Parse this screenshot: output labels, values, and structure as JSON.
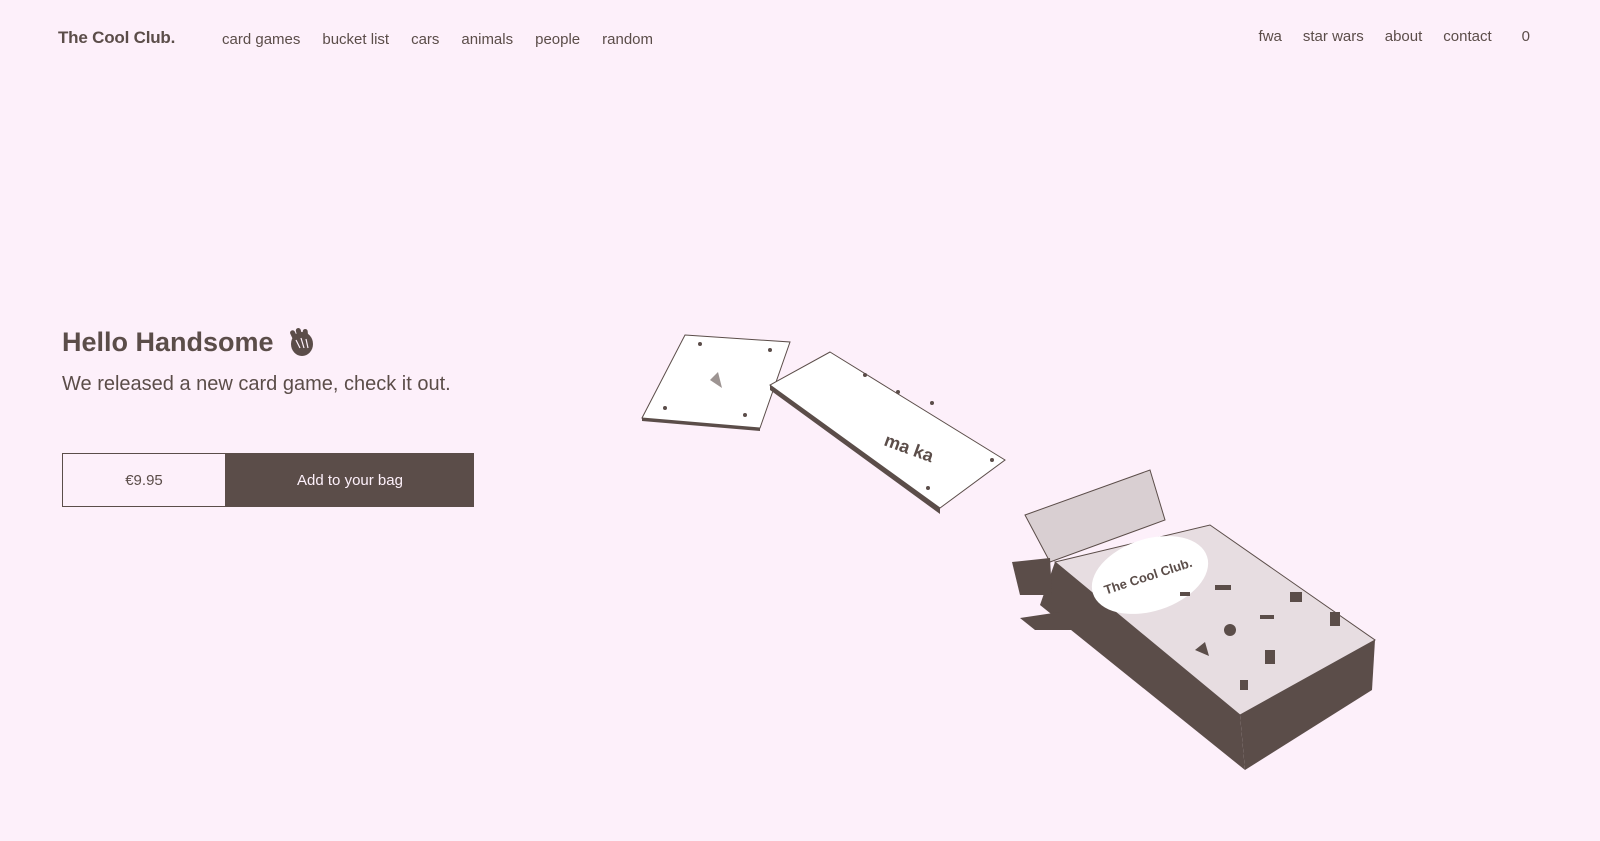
{
  "header": {
    "brand": "The Cool Club.",
    "nav_left": [
      "card games",
      "bucket list",
      "cars",
      "animals",
      "people",
      "random"
    ],
    "nav_right": [
      "fwa",
      "star wars",
      "about",
      "contact"
    ],
    "bag_count": "0"
  },
  "hero": {
    "title": "Hello Handsome",
    "title_icon": "waving-hand-icon",
    "subtitle": "We released a new card game, check it out."
  },
  "cta": {
    "price": "€9.95",
    "button_label": "Add to your bag"
  },
  "illustration": {
    "box_label": "The Cool Club."
  },
  "colors": {
    "background": "#fdf0fa",
    "primary": "#5b4d49"
  }
}
